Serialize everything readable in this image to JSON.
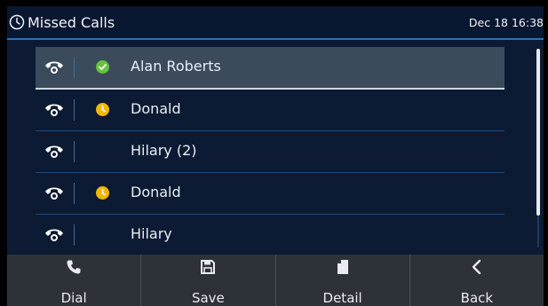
{
  "header": {
    "title": "Missed Calls",
    "datetime": "Dec 18 16:38",
    "icon": "clock-icon"
  },
  "calls": [
    {
      "name": "Alan Roberts",
      "status": "available",
      "status_color": "#67c23a",
      "selected": true
    },
    {
      "name": "Donald",
      "status": "away",
      "status_color": "#f2b705",
      "selected": false
    },
    {
      "name": "Hilary (2)",
      "status": "none",
      "selected": false
    },
    {
      "name": "Donald",
      "status": "away",
      "status_color": "#f2b705",
      "selected": false
    },
    {
      "name": "Hilary",
      "status": "none",
      "selected": false
    }
  ],
  "softkeys": [
    {
      "label": "Dial",
      "icon": "phone-icon"
    },
    {
      "label": "Save",
      "icon": "save-icon"
    },
    {
      "label": "Detail",
      "icon": "detail-icon"
    },
    {
      "label": "Back",
      "icon": "back-icon"
    }
  ],
  "colors": {
    "background": "#0c1a33",
    "accent": "#2f6fae",
    "selected_row": "#3b4b5c",
    "softkey_bar": "#2d3238"
  }
}
